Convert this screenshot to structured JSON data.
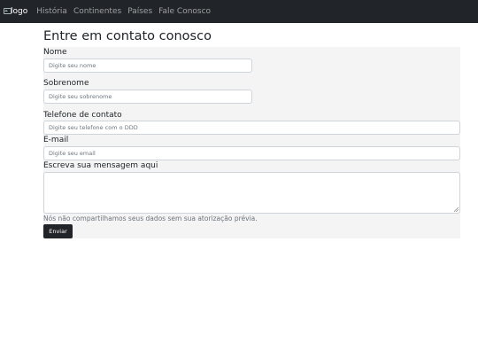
{
  "navbar": {
    "brand_alt": "logo",
    "links": [
      "História",
      "Continentes",
      "Países",
      "Fale Conosco"
    ]
  },
  "page": {
    "title": "Entre em contato conosco"
  },
  "form": {
    "nome": {
      "label": "Nome",
      "placeholder": "Digite seu nome"
    },
    "sobrenome": {
      "label": "Sobrenome",
      "placeholder": "Digite seu sobrenome"
    },
    "telefone": {
      "label": "Telefone de contato",
      "placeholder": "Digite seu telefone com o DDD"
    },
    "email": {
      "label": "E-mail",
      "placeholder": "Digite seu email"
    },
    "mensagem": {
      "label": "Escreva sua mensagem aqui"
    },
    "help_text": "Nós não compartilhamos seus dados sem sua atorização prévia.",
    "submit_label": "Enviar"
  },
  "colors": {
    "navbar_bg": "#212529",
    "panel_bg": "#f4f4f4",
    "button_bg": "#212529"
  }
}
